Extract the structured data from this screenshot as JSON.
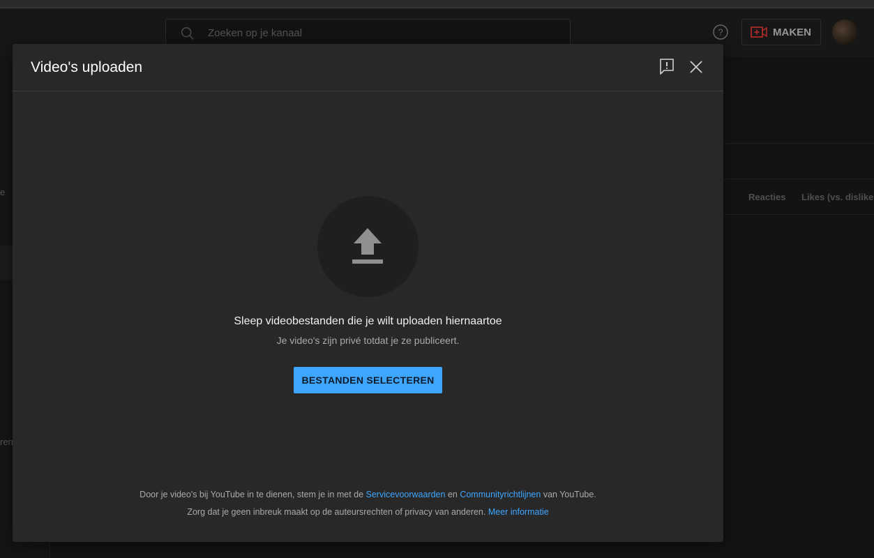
{
  "header": {
    "search_placeholder": "Zoeken op je kanaal",
    "create_label": "MAKEN"
  },
  "background": {
    "col_reacties": "Reacties",
    "col_likes": "Likes (vs. dislike...",
    "sidebar_fragment_1": "e",
    "sidebar_fragment_2": "ren"
  },
  "dialog": {
    "title": "Video's uploaden",
    "drop_text": "Sleep videobestanden die je wilt uploaden hiernaartoe",
    "private_text": "Je video's zijn privé totdat je ze publiceert.",
    "select_button": "BESTANDEN SELECTEREN",
    "legal": {
      "line1_prefix": "Door je video's bij YouTube in te dienen, stem je in met de ",
      "terms_link": "Servicevoorwaarden",
      "line1_mid": " en ",
      "guidelines_link": "Communityrichtlijnen",
      "line1_suffix": " van YouTube.",
      "line2_prefix": "Zorg dat je geen inbreuk maakt op de auteursrechten of privacy van anderen. ",
      "more_link": "Meer informatie"
    }
  },
  "colors": {
    "accent": "#3ea6ff",
    "dialog_bg": "#282828",
    "create_icon": "#e53935"
  }
}
